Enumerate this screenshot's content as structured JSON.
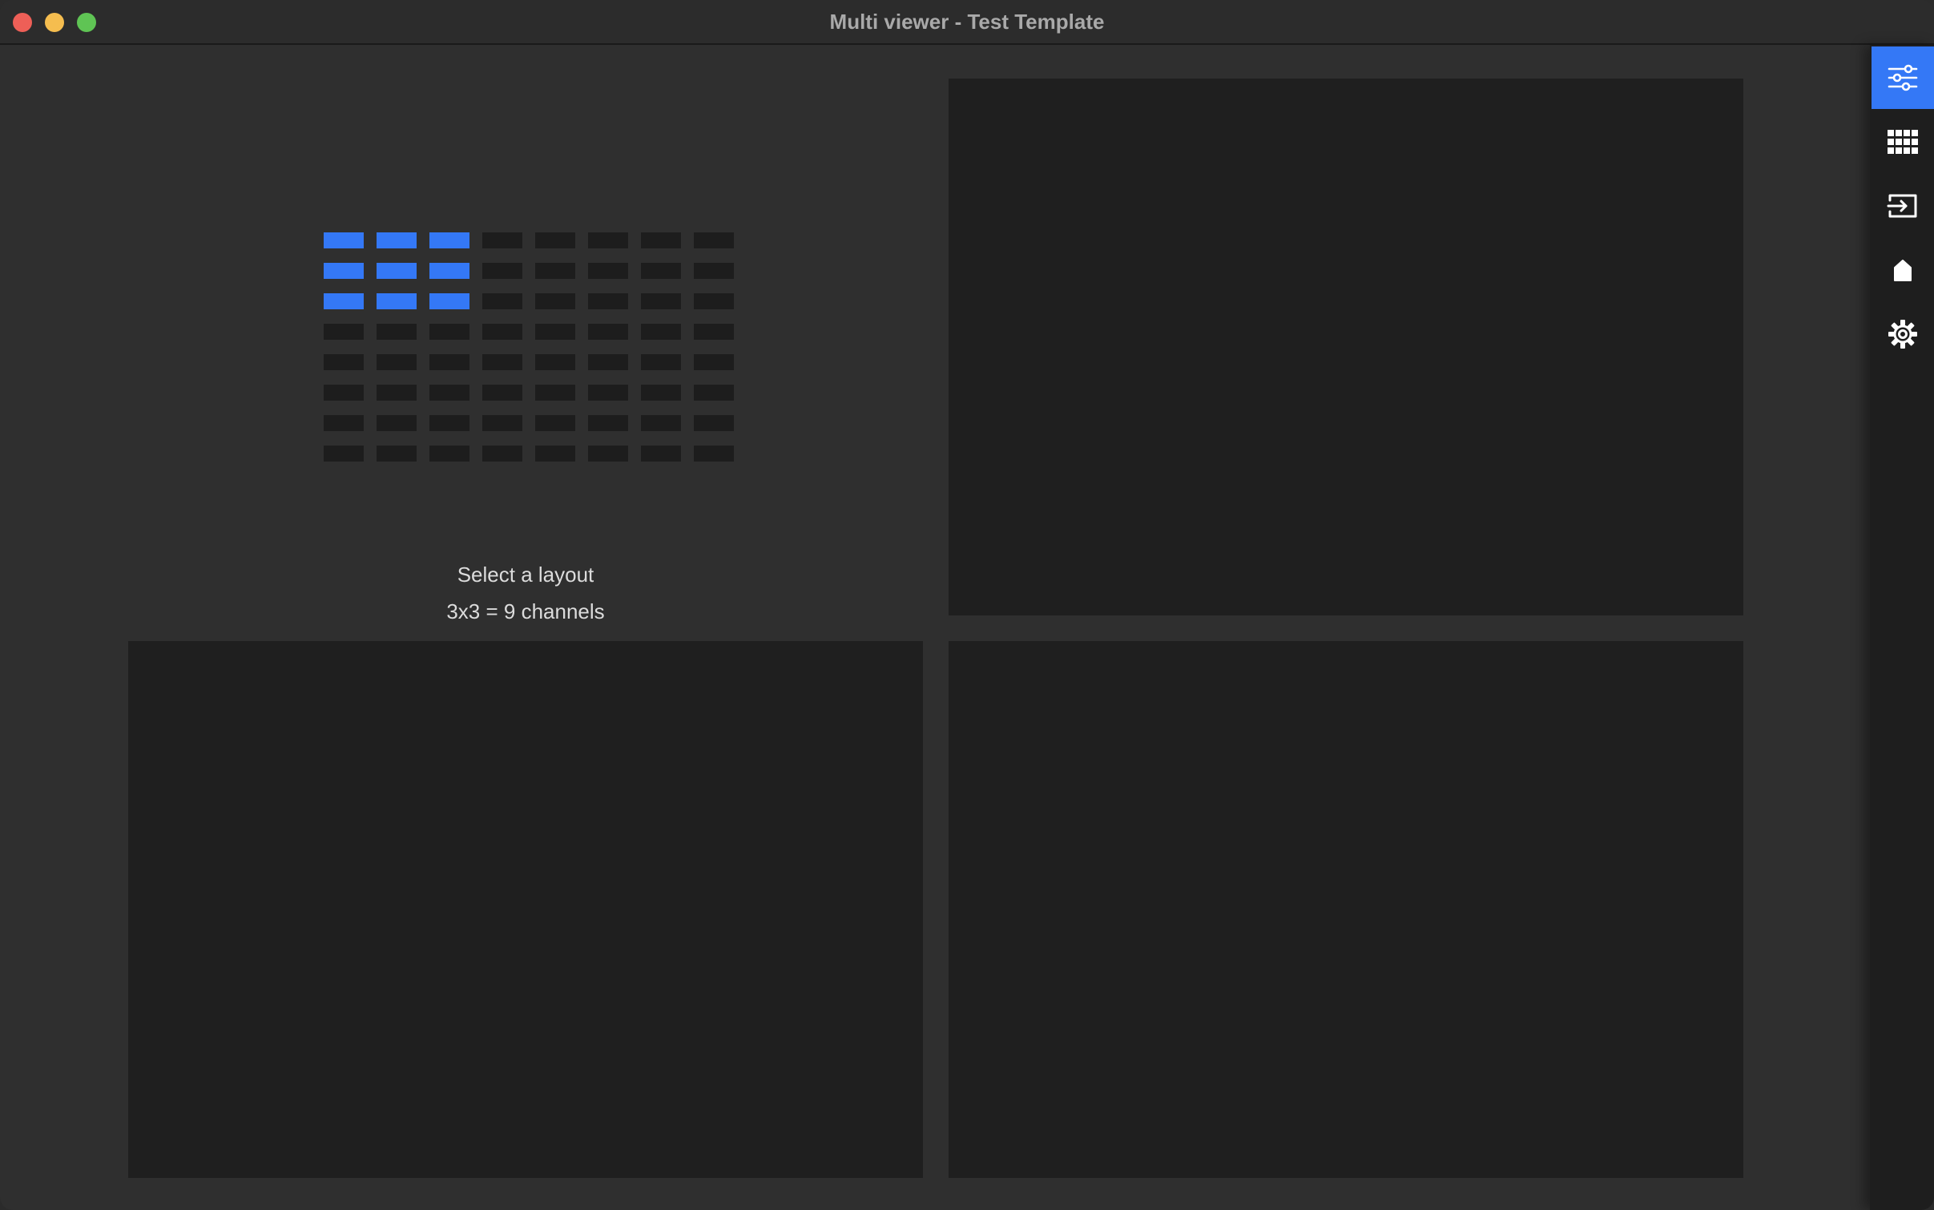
{
  "window": {
    "title": "Multi viewer - Test Template"
  },
  "layout_selector": {
    "caption": "Select a layout",
    "selection": "3x3 = 9 channels",
    "grid": {
      "rows": 8,
      "columns": 8,
      "selected_rows": 3,
      "selected_columns": 3
    }
  },
  "sidebar": {
    "items": [
      {
        "icon": "sliders-icon",
        "active": true
      },
      {
        "icon": "grid-icon",
        "active": false
      },
      {
        "icon": "input-icon",
        "active": false
      },
      {
        "icon": "home-icon",
        "active": false
      },
      {
        "icon": "gear-icon",
        "active": false
      }
    ]
  },
  "colors": {
    "accent": "#3478f6",
    "background": "#2f2f2f",
    "tile": "#1f1f1f",
    "sidebar": "#1e1e1e"
  }
}
